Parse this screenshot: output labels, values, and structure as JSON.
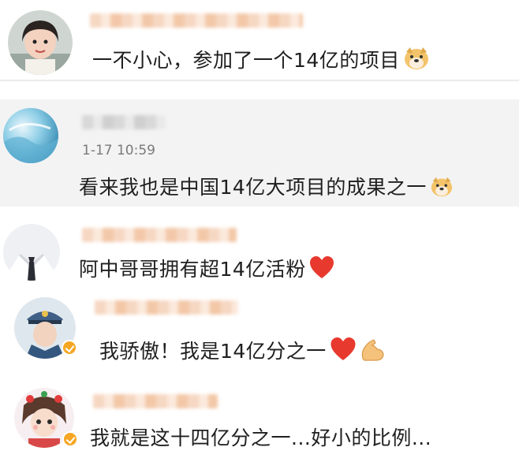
{
  "comments": [
    {
      "text": "一不小心，参加了一个14亿的项目",
      "emoji": "doge-emoji"
    },
    {
      "timestamp": "1-17 10:59",
      "text": "看来我也是中国14亿大项目的成果之一",
      "emoji": "doge-emoji"
    },
    {
      "text": "阿中哥哥拥有超14亿活粉",
      "emoji": "heart-emoji"
    },
    {
      "text": "我骄傲！我是14亿分之一",
      "emoji": "heart-and-flexed-arm-emoji"
    },
    {
      "text": "我就是这十四亿分之一...好小的比例..."
    }
  ],
  "colors": {
    "heart": "#e8392f",
    "badge": "#f5a623",
    "highlight_bg": "#f3f3f4"
  }
}
